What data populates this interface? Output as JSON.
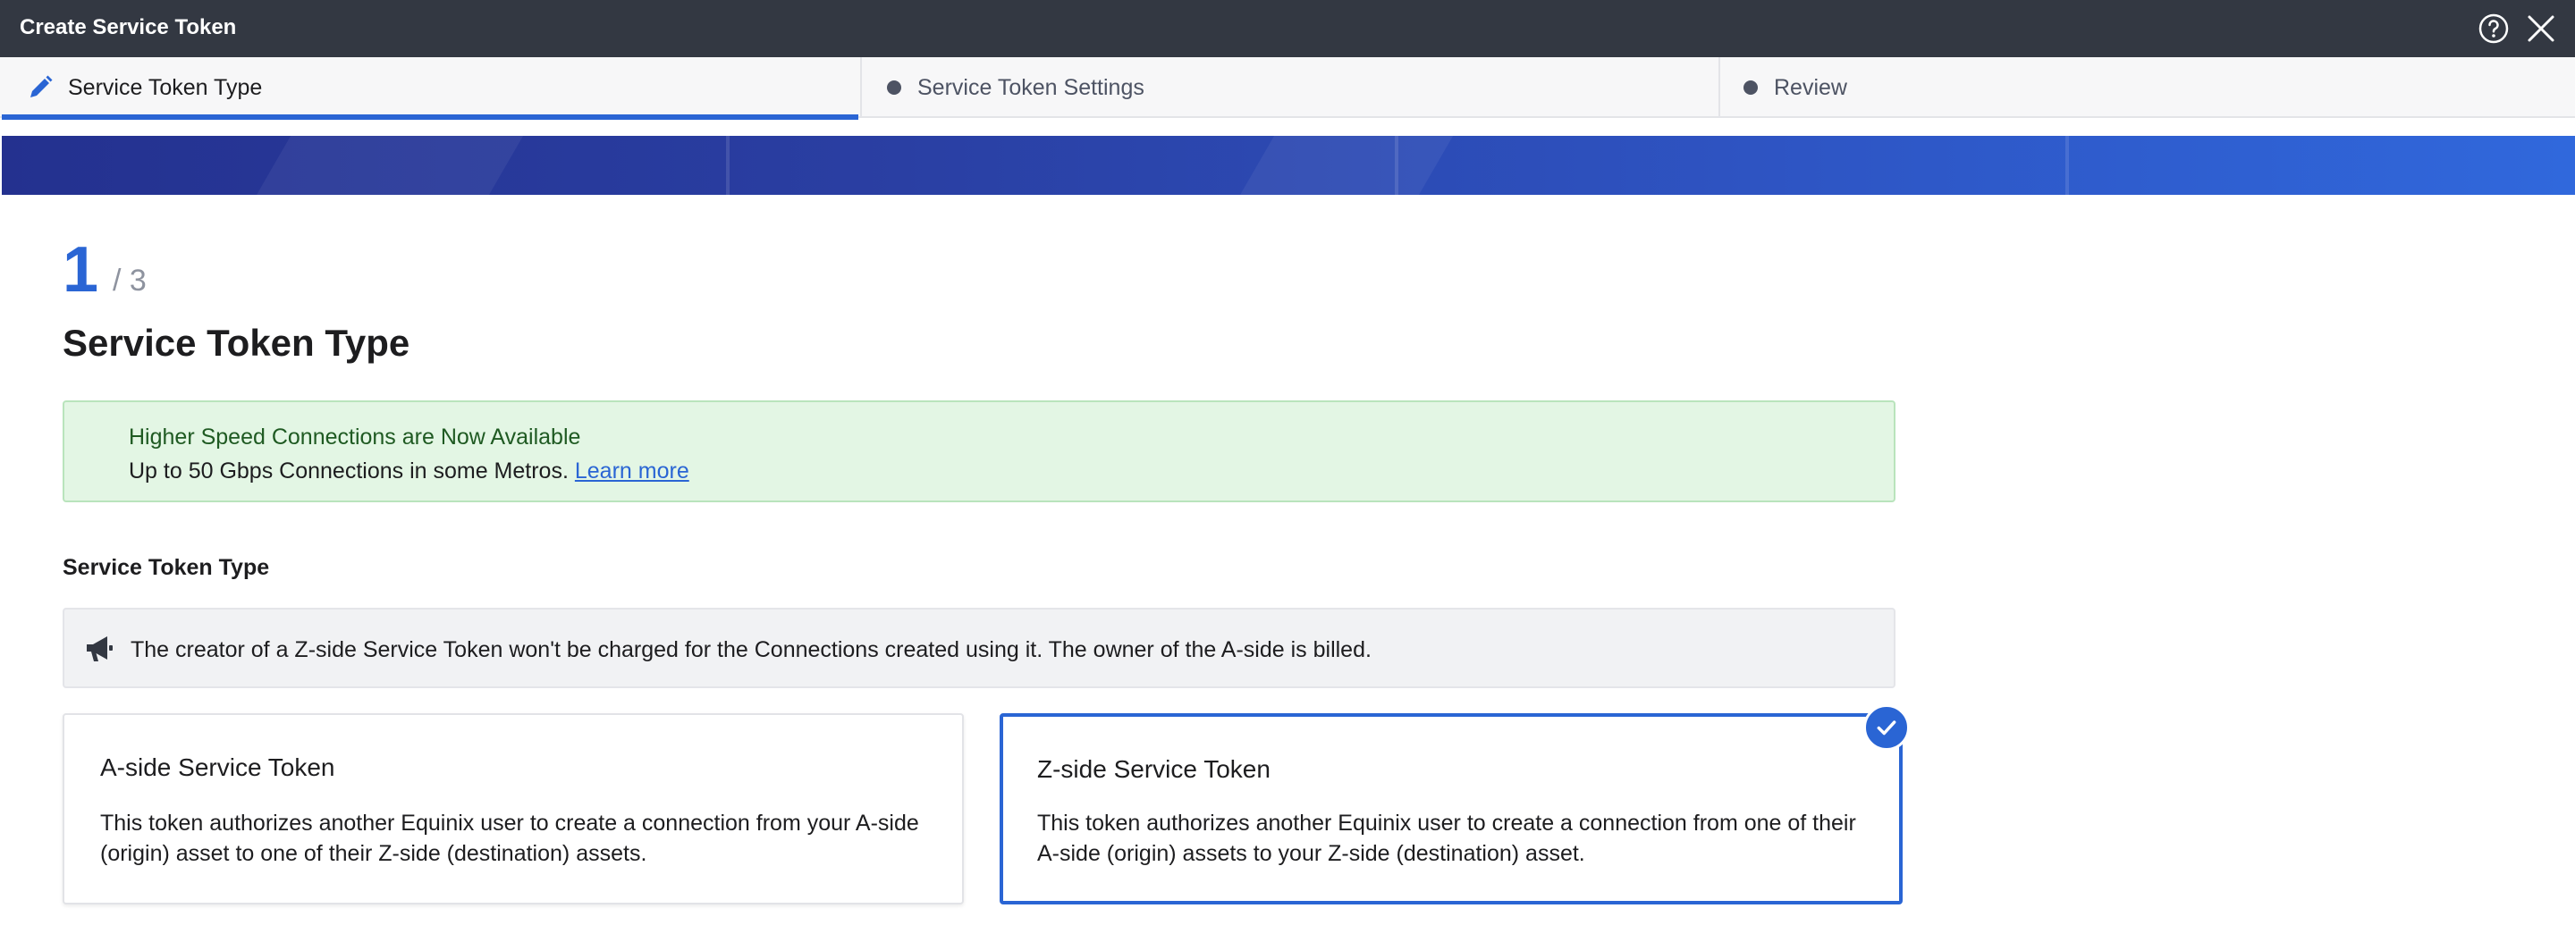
{
  "window": {
    "title": "Create Service Token",
    "help_icon": "help-circle-icon",
    "close_icon": "close-icon"
  },
  "steps": {
    "tabs": [
      {
        "label": "Service Token Type",
        "state": "active",
        "icon": "pencil-icon"
      },
      {
        "label": "Service Token Settings",
        "state": "pending",
        "icon": "dot-icon"
      },
      {
        "label": "Review",
        "state": "pending",
        "icon": "dot-icon"
      }
    ],
    "current": "1",
    "total": "/ 3"
  },
  "page": {
    "title": "Service Token Type"
  },
  "notice": {
    "title": "Higher Speed Connections are Now Available",
    "body": "Up to 50 Gbps Connections in some Metros.",
    "link": "Learn more"
  },
  "section": {
    "label": "Service Token Type",
    "info": "The creator of a Z-side Service Token won't be charged for the Connections created using it. The owner of the A-side is billed.",
    "info_icon": "megaphone-icon"
  },
  "options": [
    {
      "title": "A-side Service Token",
      "description": "This token authorizes another Equinix user to create a connection from your A-side (origin) asset to one of their Z-side (destination) assets.",
      "selected": false
    },
    {
      "title": "Z-side Service Token",
      "description": "This token authorizes another Equinix user to create a connection from one of their A-side (origin) assets to your Z-side (destination) asset.",
      "selected": true
    }
  ],
  "colors": {
    "accent": "#2a65d4",
    "titlebar": "#333842",
    "notice_bg": "#e3f6e4",
    "notice_title": "#1f5a22"
  }
}
